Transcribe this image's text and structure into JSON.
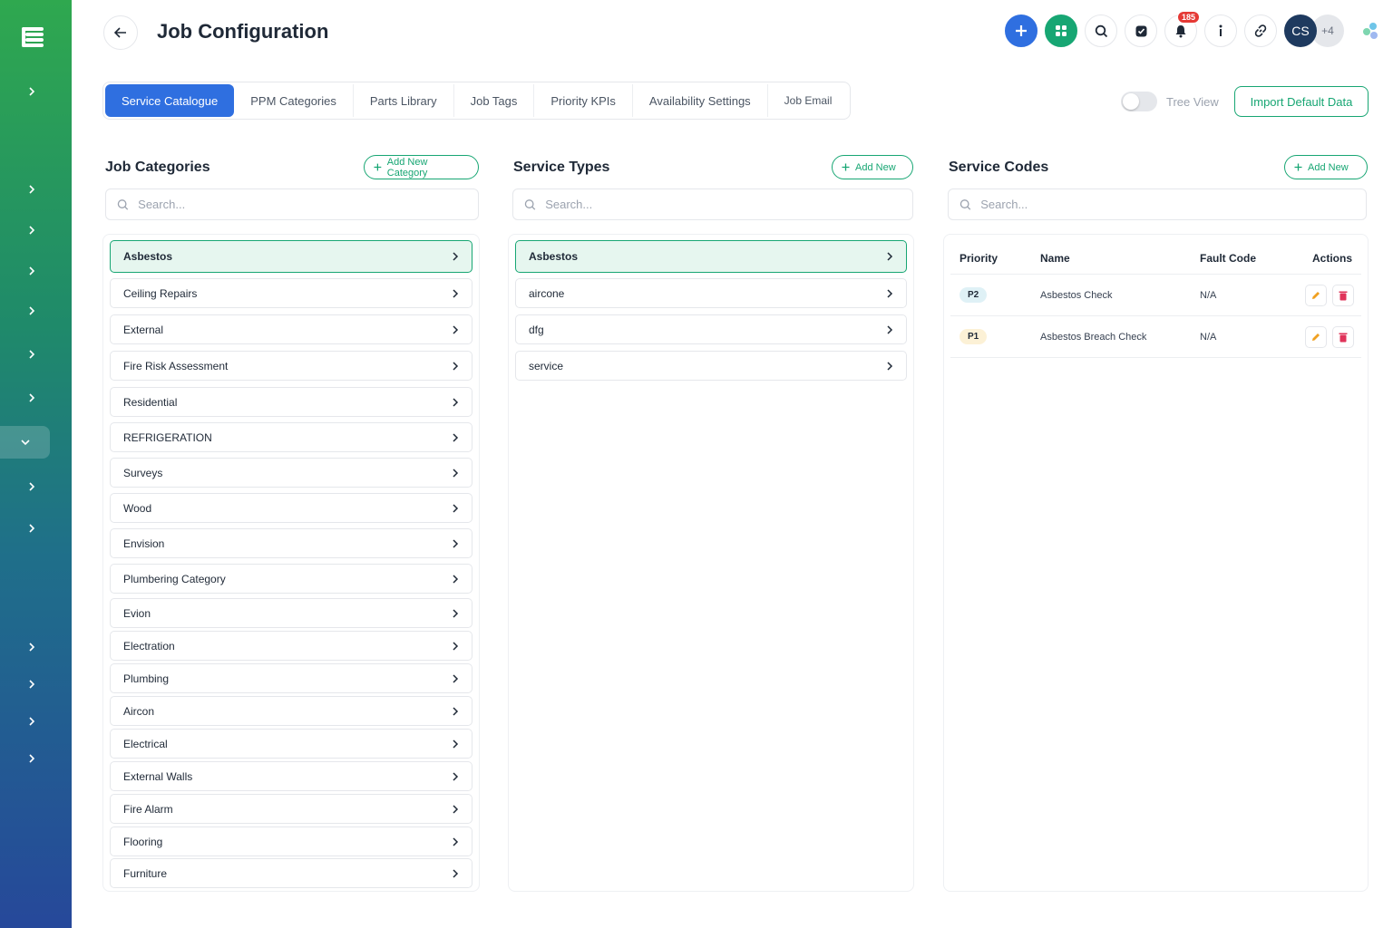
{
  "header": {
    "title": "Job Configuration",
    "notification_count": "185",
    "avatar_initials": "CS",
    "avatar_more": "+4"
  },
  "tabs": [
    {
      "label": "Service Catalogue",
      "active": true
    },
    {
      "label": "PPM Categories"
    },
    {
      "label": "Parts Library"
    },
    {
      "label": "Job Tags"
    },
    {
      "label": "Priority KPIs"
    },
    {
      "label": "Availability Settings"
    },
    {
      "label": "Job Email"
    }
  ],
  "tree_view_label": "Tree View",
  "import_label": "Import Default Data",
  "job_categories": {
    "title": "Job Categories",
    "add_label": "Add New Category",
    "search_placeholder": "Search...",
    "items": [
      "Asbestos",
      "Ceiling Repairs",
      "External",
      "Fire Risk Assessment",
      "Residential",
      "REFRIGERATION",
      "Surveys",
      "Wood",
      "Envision",
      "Plumbering Category",
      "Evion",
      "Electration",
      "Plumbing",
      "Aircon",
      "Electrical",
      "External Walls",
      "Fire Alarm",
      "Flooring",
      "Furniture"
    ],
    "selected": "Asbestos"
  },
  "service_types": {
    "title": "Service Types",
    "add_label": "Add New",
    "search_placeholder": "Search...",
    "items": [
      "Asbestos",
      "aircone",
      "dfg",
      "service"
    ],
    "selected": "Asbestos"
  },
  "service_codes": {
    "title": "Service Codes",
    "add_label": "Add New",
    "search_placeholder": "Search...",
    "columns": [
      "Priority",
      "Name",
      "Fault Code",
      "Actions"
    ],
    "rows": [
      {
        "priority": "P2",
        "name": "Asbestos Check",
        "fault_code": "N/A"
      },
      {
        "priority": "P1",
        "name": "Asbestos Breach Check",
        "fault_code": "N/A"
      }
    ]
  },
  "colors": {
    "primary": "#2f6fe0",
    "accent": "#17a673",
    "selected_bg": "#e6f6ef",
    "delete": "#e0335a",
    "edit": "#f0a020"
  }
}
